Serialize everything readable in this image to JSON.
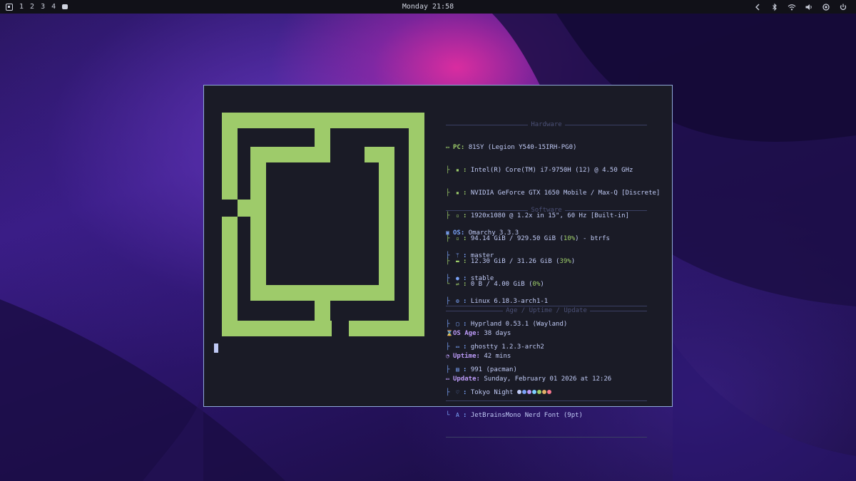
{
  "topbar": {
    "workspaces": [
      "1",
      "2",
      "3",
      "4"
    ],
    "clock": "Monday 21:58",
    "tray_icons": [
      "chevron-left-icon",
      "bluetooth-icon",
      "wifi-icon",
      "volume-icon",
      "settings-icon",
      "power-icon"
    ]
  },
  "terminal": {
    "hardware": {
      "title": "Hardware",
      "pc_key": "PC",
      "pc_value": "81SY (Legion Y540-15IRH-PG0)",
      "cpu": "Intel(R) Core(TM) i7-9750H (12) @ 4.50 GHz",
      "gpu": "NVIDIA GeForce GTX 1650 Mobile / Max-Q [Discrete]",
      "display": "1920x1080 @ 1.2x in 15\", 60 Hz [Built-in]",
      "disk": "94.14 GiB / 929.50 GiB",
      "disk_pct": "10%",
      "disk_fs": " - btrfs",
      "memory": "12.30 GiB / 31.26 GiB",
      "memory_pct": "39%",
      "swap": "0 B / 4.00 GiB",
      "swap_pct": "0%"
    },
    "software": {
      "title": "Software",
      "os_key": "OS",
      "os_value": "Omarchy 3.3.3",
      "branch": "master",
      "channel": "stable",
      "kernel": "Linux 6.18.3-arch1-1",
      "wm": "Hyprland 0.53.1 (Wayland)",
      "terminal": "ghostty 1.2.3-arch2",
      "packages": "991 (pacman)",
      "theme": "Tokyo Night",
      "theme_colors": [
        "#c0caf5",
        "#7aa2f7",
        "#bb9af7",
        "#7dcfff",
        "#9ece6a",
        "#e0af68",
        "#f7768e"
      ],
      "font": "JetBrainsMono Nerd Font (9pt)"
    },
    "age": {
      "title": "Age / Uptime / Update",
      "os_age_key": "OS Age",
      "os_age": "38 days",
      "uptime_key": "Uptime",
      "uptime": "42 mins",
      "update_key": "Update",
      "update": "Sunday, February 01 2026 at 12:26"
    },
    "colors": {
      "logo": "#9ecb6a",
      "background": "#1a1b26",
      "border": "#8fa8d8"
    }
  }
}
